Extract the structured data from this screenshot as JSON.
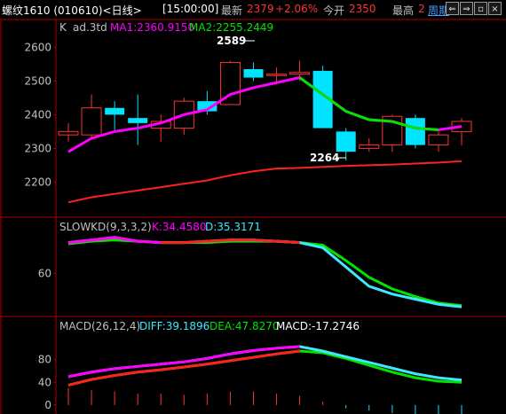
{
  "header": {
    "symbol": "螺纹1610 (010610)<日线>",
    "time": "[15:00:00]",
    "last_label": "最新",
    "last_value": "2379",
    "change_pct": "+2.06%",
    "open_label": "今开",
    "open_value": "2350",
    "high_label": "最高",
    "high_value": "2",
    "period_label": "周期"
  },
  "colors": {
    "up": "#ff3232",
    "down": "#00e4ff",
    "ma1": "#ff00ff",
    "ma2": "#ff2020",
    "k_line": "#ff00ff",
    "d_line": "#40e8ff",
    "diff": "#40e8ff",
    "dea": "#00e400",
    "axis": "#b00000",
    "text": "#c0c0c0",
    "green": "#00e400",
    "white": "#ffffff"
  },
  "chart_data": [
    {
      "type": "candlestick",
      "panel": "main",
      "label_k": "K",
      "label_name": "ad.3td",
      "ma1_label": "MA1:2360.9150",
      "ma2_label": "MA2:2255.2449",
      "yticks": [
        2600,
        2500,
        2400,
        2300,
        2200
      ],
      "ylim": [
        2130,
        2635
      ],
      "annotations": [
        {
          "text": "2589",
          "type": "high"
        },
        {
          "text": "2264",
          "type": "low"
        }
      ],
      "candles": [
        {
          "o": 2340,
          "h": 2375,
          "l": 2320,
          "c": 2350
        },
        {
          "o": 2340,
          "h": 2460,
          "l": 2330,
          "c": 2420
        },
        {
          "o": 2420,
          "h": 2440,
          "l": 2355,
          "c": 2400
        },
        {
          "o": 2390,
          "h": 2460,
          "l": 2310,
          "c": 2375
        },
        {
          "o": 2360,
          "h": 2400,
          "l": 2320,
          "c": 2380
        },
        {
          "o": 2360,
          "h": 2450,
          "l": 2340,
          "c": 2440
        },
        {
          "o": 2440,
          "h": 2470,
          "l": 2400,
          "c": 2410
        },
        {
          "o": 2430,
          "h": 2560,
          "l": 2430,
          "c": 2555
        },
        {
          "o": 2535,
          "h": 2555,
          "l": 2500,
          "c": 2510
        },
        {
          "o": 2520,
          "h": 2540,
          "l": 2490,
          "c": 2520
        },
        {
          "o": 2520,
          "h": 2560,
          "l": 2500,
          "c": 2525
        },
        {
          "o": 2530,
          "h": 2545,
          "l": 2360,
          "c": 2360
        },
        {
          "o": 2350,
          "h": 2360,
          "l": 2264,
          "c": 2290
        },
        {
          "o": 2300,
          "h": 2330,
          "l": 2290,
          "c": 2310
        },
        {
          "o": 2310,
          "h": 2400,
          "l": 2290,
          "c": 2395
        },
        {
          "o": 2390,
          "h": 2400,
          "l": 2300,
          "c": 2310
        },
        {
          "o": 2310,
          "h": 2350,
          "l": 2290,
          "c": 2340
        },
        {
          "o": 2350,
          "h": 2390,
          "l": 2310,
          "c": 2380
        }
      ],
      "ma1": [
        2290,
        2330,
        2350,
        2360,
        2375,
        2400,
        2415,
        2460,
        2480,
        2495,
        2510,
        2460,
        2410,
        2385,
        2380,
        2360,
        2355,
        2365
      ],
      "ma2": [
        2140,
        2155,
        2165,
        2175,
        2185,
        2195,
        2205,
        2220,
        2232,
        2240,
        2242,
        2245,
        2248,
        2250,
        2252,
        2255,
        2258,
        2262
      ]
    },
    {
      "type": "line",
      "panel": "slowkd",
      "label": "SLOWKD(9,3,3,2)",
      "k_label": "K:34.4580",
      "d_label": "D:35.3171",
      "yticks": [
        60
      ],
      "ylim": [
        30,
        92
      ],
      "k": [
        84,
        86,
        88,
        85,
        84,
        84,
        85,
        86,
        86,
        85,
        84,
        80,
        65,
        50,
        44,
        40,
        36,
        34
      ],
      "d": [
        83,
        85,
        86,
        85,
        84,
        84,
        84,
        85,
        85,
        85,
        84,
        82,
        70,
        57,
        48,
        42,
        37,
        35
      ]
    },
    {
      "type": "line",
      "panel": "macd",
      "label": "MACD(26,12,4)",
      "diff_label": "DIFF:39.1896",
      "dea_label": "DEA:47.8270",
      "macd_label": "MACD:-17.2746",
      "yticks": [
        80,
        40,
        0
      ],
      "ylim": [
        -8,
        120
      ],
      "diff": [
        50,
        58,
        64,
        68,
        72,
        76,
        82,
        90,
        96,
        100,
        103,
        95,
        85,
        75,
        65,
        55,
        48,
        44
      ],
      "dea": [
        35,
        45,
        52,
        58,
        62,
        67,
        72,
        78,
        84,
        90,
        95,
        92,
        82,
        70,
        58,
        48,
        42,
        40
      ],
      "macd": [
        30,
        26,
        24,
        20,
        20,
        18,
        20,
        24,
        24,
        20,
        16,
        6,
        -6,
        -10,
        -14,
        -16,
        -16,
        -17
      ]
    }
  ]
}
